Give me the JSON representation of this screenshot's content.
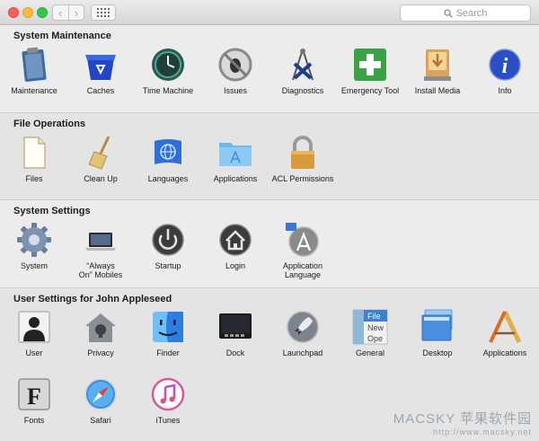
{
  "toolbar": {
    "back_glyph": "‹",
    "forward_glyph": "›",
    "search_placeholder": "Search",
    "icons": [
      "close-icon",
      "minimize-icon",
      "zoom-icon",
      "back-icon",
      "forward-icon",
      "grid-icon",
      "search-icon"
    ]
  },
  "colors": {
    "window_bg": "#ececec",
    "traffic_red": "#fc605c",
    "traffic_yellow": "#fdbc40",
    "traffic_green": "#34c84a"
  },
  "sections": [
    {
      "title": "System Maintenance",
      "items": [
        {
          "label": "Maintenance",
          "icon": "clipboard-icon"
        },
        {
          "label": "Caches",
          "icon": "recycle-bin-icon"
        },
        {
          "label": "Time Machine",
          "icon": "time-machine-icon"
        },
        {
          "label": "Issues",
          "icon": "no-bug-icon"
        },
        {
          "label": "Diagnostics",
          "icon": "calipers-icon"
        },
        {
          "label": "Emergency Tool",
          "icon": "first-aid-icon"
        },
        {
          "label": "Install Media",
          "icon": "install-drive-icon"
        },
        {
          "label": "Info",
          "icon": "info-icon"
        }
      ]
    },
    {
      "title": "File Operations",
      "items": [
        {
          "label": "Files",
          "icon": "document-icon"
        },
        {
          "label": "Clean Up",
          "icon": "broom-icon"
        },
        {
          "label": "Languages",
          "icon": "flag-globe-icon"
        },
        {
          "label": "Applications",
          "icon": "applications-folder-icon"
        },
        {
          "label": "ACL Permissions",
          "icon": "padlock-icon"
        }
      ]
    },
    {
      "title": "System Settings",
      "items": [
        {
          "label": "System",
          "icon": "gear-icon"
        },
        {
          "label": "“Always",
          "label2": "On” Mobiles",
          "icon": "laptop-icon"
        },
        {
          "label": "Startup",
          "icon": "power-icon"
        },
        {
          "label": "Login",
          "icon": "home-icon"
        },
        {
          "label": "Application",
          "label2": "Language",
          "icon": "app-store-flag-icon"
        }
      ]
    },
    {
      "title": "User Settings for John Appleseed",
      "items": [
        {
          "label": "User",
          "icon": "user-silhouette-icon"
        },
        {
          "label": "Privacy",
          "icon": "privacy-house-icon"
        },
        {
          "label": "Finder",
          "icon": "finder-icon"
        },
        {
          "label": "Dock",
          "icon": "dock-icon"
        },
        {
          "label": "Launchpad",
          "icon": "rocket-icon"
        },
        {
          "label": "General",
          "icon": "general-file-icon",
          "text": [
            "File",
            "New",
            "Ope"
          ]
        },
        {
          "label": "Desktop",
          "icon": "desktop-icon"
        },
        {
          "label": "Applications",
          "icon": "pencil-ruler-icon"
        },
        {
          "label": "Fonts",
          "icon": "fonts-icon",
          "glyph": "F"
        },
        {
          "label": "Safari",
          "icon": "safari-compass-icon"
        },
        {
          "label": "iTunes",
          "icon": "itunes-note-icon"
        }
      ]
    }
  ],
  "watermark": {
    "main": "MACSKY 苹果软件园",
    "url": "http://www.macsky.net"
  }
}
